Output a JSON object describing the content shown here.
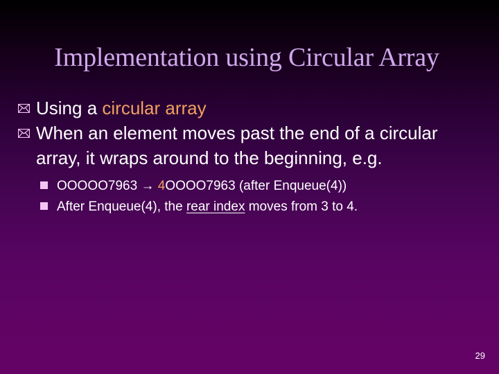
{
  "slide": {
    "title": "Implementation using Circular Array",
    "page_number": "29",
    "bullets": [
      {
        "icon": "envelope-icon",
        "text_before": "Using a ",
        "text_highlight": "circular array"
      },
      {
        "icon": "envelope-icon",
        "line1": "When an element moves past the end of a circular",
        "line2": "array, it wraps around to the beginning, e.g."
      }
    ],
    "sub_bullets": [
      {
        "icon": "square-bullet-icon",
        "before": "OOOOO7963 ",
        "arrow": "→",
        "space": " ",
        "highlight": "4",
        "after": "OOOO7963 (after Enqueue(4))"
      },
      {
        "icon": "square-bullet-icon",
        "before": "After Enqueue(4), the ",
        "underlined": "rear index",
        "after": " moves from 3 to 4."
      }
    ]
  },
  "colors": {
    "title": "#d0a8ec",
    "accent": "#f0a060",
    "bullet_marker": "#f4c4f4",
    "text": "#ffffff",
    "background_top": "#000000",
    "background_bottom": "#650366"
  }
}
